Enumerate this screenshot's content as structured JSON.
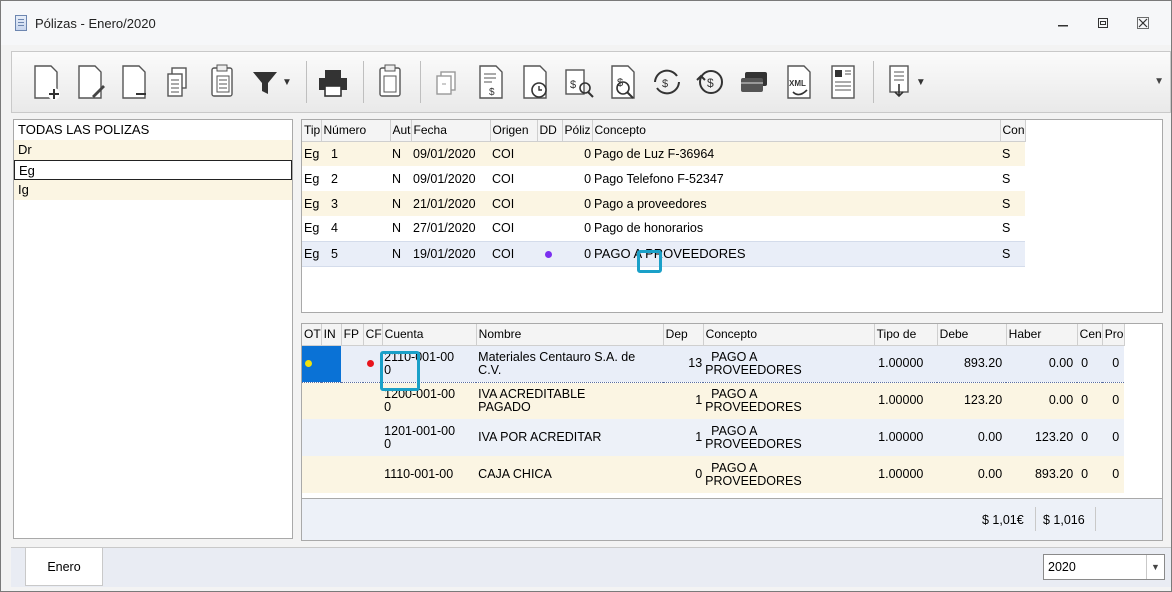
{
  "window": {
    "title": "Pólizas - Enero/2020"
  },
  "icons": {
    "app": "document-list-icon",
    "minimize": "minimize-icon",
    "restore": "restore-icon",
    "close": "close-icon"
  },
  "toolbar": {
    "buttons": [
      "new-document-icon",
      "edit-document-icon",
      "blank-document-icon",
      "copy-icon",
      "paste-icon",
      "filter-icon",
      "print-icon",
      "clipboard-icon",
      "attach-icon",
      "report-icon",
      "history-icon",
      "search-money-icon",
      "search-document-icon",
      "exchange-icon",
      "exchange-dollar-icon",
      "payment-card-icon",
      "xml-icon",
      "barcode-icon",
      "export-icon"
    ]
  },
  "left_panel": {
    "items": [
      "TODAS LAS POLIZAS",
      "Dr",
      "Eg",
      "Ig"
    ],
    "selected": "Eg"
  },
  "polizas": {
    "columns": [
      "Tip",
      "Número",
      "Aut",
      "Fecha",
      "Origen",
      "DD",
      "Póliz",
      "Concepto",
      "Con"
    ],
    "rows": [
      {
        "tipo": "Eg",
        "numero": "1",
        "aut": "N",
        "fecha": "09/01/2020",
        "origen": "COI",
        "poliza": "0",
        "concepto": "Pago de Luz F-36964",
        "con": "S"
      },
      {
        "tipo": "Eg",
        "numero": "2",
        "aut": "N",
        "fecha": "09/01/2020",
        "origen": "COI",
        "poliza": "0",
        "concepto": "Pago Telefono F-52347",
        "con": "S"
      },
      {
        "tipo": "Eg",
        "numero": "3",
        "aut": "N",
        "fecha": "21/01/2020",
        "origen": "COI",
        "poliza": "0",
        "concepto": "Pago a proveedores",
        "con": "S"
      },
      {
        "tipo": "Eg",
        "numero": "4",
        "aut": "N",
        "fecha": "27/01/2020",
        "origen": "COI",
        "poliza": "0",
        "concepto": "Pago de honorarios",
        "con": "S"
      },
      {
        "tipo": "Eg",
        "numero": "5",
        "aut": "N",
        "fecha": "19/01/2020",
        "origen": "COI",
        "poliza": "0",
        "concepto": " PAGO A PROVEEDORES",
        "con": "S"
      }
    ],
    "dd_marker_color": "#7b2ff0"
  },
  "movimientos": {
    "columns": [
      "OT",
      "IN",
      "FP",
      "CF",
      "Cuenta",
      "Nombre",
      "Dep",
      "Concepto",
      "Tipo de",
      "Debe",
      "Haber",
      "Cen",
      "Pro"
    ],
    "rows": [
      {
        "cuenta_a": "2110-001-00",
        "cuenta_b": "0",
        "nombre_a": "Materiales Centauro S.A. de",
        "nombre_b": "C.V.",
        "dep": "13",
        "concepto_a": "PAGO A",
        "concepto_b": "PROVEEDORES",
        "tipo": "1.00000",
        "debe": "893.20",
        "haber": "0.00",
        "cen": "0",
        "pro": "0"
      },
      {
        "cuenta_a": "1200-001-00",
        "cuenta_b": "0",
        "nombre_a": "IVA ACREDITABLE",
        "nombre_b": "PAGADO",
        "dep": "1",
        "concepto_a": "PAGO A",
        "concepto_b": "PROVEEDORES",
        "tipo": "1.00000",
        "debe": "123.20",
        "haber": "0.00",
        "cen": "0",
        "pro": "0"
      },
      {
        "cuenta_a": "1201-001-00",
        "cuenta_b": "0",
        "nombre_a": "IVA POR ACREDITAR",
        "nombre_b": "",
        "dep": "1",
        "concepto_a": "PAGO A",
        "concepto_b": "PROVEEDORES",
        "tipo": "1.00000",
        "debe": "0.00",
        "haber": "123.20",
        "cen": "0",
        "pro": "0"
      },
      {
        "cuenta_a": "1110-001-00",
        "cuenta_b": "",
        "nombre_a": "CAJA CHICA",
        "nombre_b": "",
        "dep": "0",
        "concepto_a": "PAGO A",
        "concepto_b": "PROVEEDORES",
        "tipo": "1.00000",
        "debe": "0.00",
        "haber": "893.20",
        "cen": "0",
        "pro": "0"
      }
    ],
    "ot_marker_color": "#f2e20c",
    "cf_marker_color": "#e8141c",
    "totals": {
      "debe": "$ 1,01€",
      "haber": "$ 1,016"
    }
  },
  "status": {
    "period_tab": "Enero",
    "year": "2020"
  },
  "colors": {
    "highlight": "#1aa0c8",
    "selection_blue": "#0a72d6"
  }
}
